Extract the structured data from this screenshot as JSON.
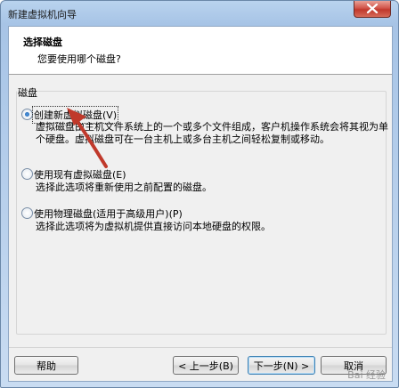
{
  "window": {
    "title": "新建虚拟机向导"
  },
  "header": {
    "title": "选择磁盘",
    "subtitle": "您要使用哪个磁盘?"
  },
  "group": {
    "label": "磁盘"
  },
  "options": [
    {
      "label": "创建新虚拟磁盘(V)",
      "desc1": "虚拟磁盘由主机文件系统上的一个或多个文件组成，客户机操作系统会将其视为单",
      "desc2": "个硬盘。虚拟磁盘可在一台主机上或多台主机之间轻松复制或移动。",
      "checked": true
    },
    {
      "label": "使用现有虚拟磁盘(E)",
      "desc1": "选择此选项将重新使用之前配置的磁盘。",
      "checked": false
    },
    {
      "label": "使用物理磁盘(适用于高级用户)(P)",
      "desc1": "选择此选项将为虚拟机提供直接访问本地硬盘的权限。",
      "checked": false
    }
  ],
  "buttons": {
    "help": "帮助",
    "back": "< 上一步(B)",
    "next": "下一步(N) >",
    "cancel": "取消"
  },
  "watermark": "Bai 经验",
  "colors": {
    "arrow": "#c0392b",
    "close_button": "#c1382c"
  }
}
